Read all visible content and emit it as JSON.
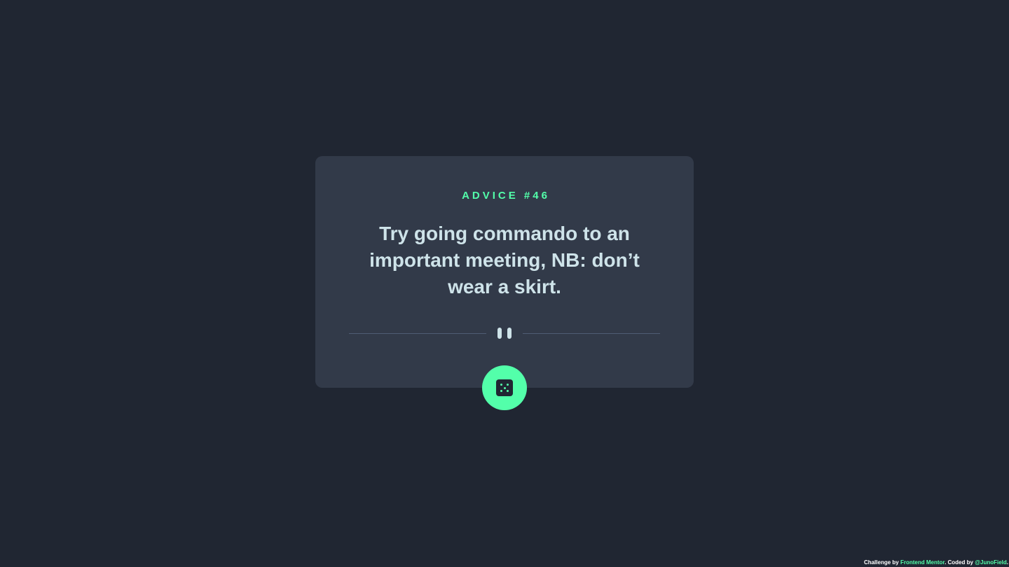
{
  "card": {
    "advice_label": "ADVICE #46",
    "quote": "Try going commando to an important meeting, NB: don’t wear a skirt."
  },
  "icons": {
    "divider": "pause-icon",
    "button": "dice-icon"
  },
  "colors": {
    "background": "#202632",
    "card": "#323a49",
    "accent": "#53ffaa",
    "text": "#cee3e9",
    "divider": "#4f5d74"
  },
  "attribution": {
    "prefix": "Challenge by ",
    "frontend_mentor": "Frontend Mentor",
    "middle": ". Coded by ",
    "author": "@JunoField",
    "suffix": "."
  }
}
